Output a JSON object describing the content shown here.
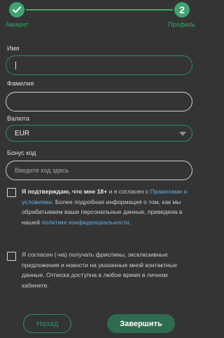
{
  "stepper": {
    "step1_label": "Аккаунт",
    "step2_number": "2",
    "step2_label": "Профиль",
    "step1_icon": "check-icon",
    "accent_color": "#3fa56e"
  },
  "form": {
    "first_name_label": "Имя",
    "first_name_value": "",
    "last_name_label": "Фамилия",
    "last_name_value": "",
    "currency_label": "Валюта",
    "currency_value": "EUR",
    "bonus_label": "Бонус код",
    "bonus_placeholder": "Введите код здесь"
  },
  "consents": {
    "age_bold": "Я подтверждаю, что мне 18+",
    "age_text_1": " и я согласен с ",
    "age_link_1": "Правилами и условиями",
    "age_text_2": ". Более подробная информация о том, как мы обрабатываем ваши персональные данные, приведена в нашей ",
    "age_link_2": "политике конфиденциальности",
    "age_text_3": ".",
    "promo_text": "Я согласен (-на) получать фриспины, эксклюзивные предложения и новости на указанные мной контактные данные. Отписка доступна в любое время в личном кабинете."
  },
  "buttons": {
    "back_label": "Назад",
    "finish_label": "Завершить"
  }
}
